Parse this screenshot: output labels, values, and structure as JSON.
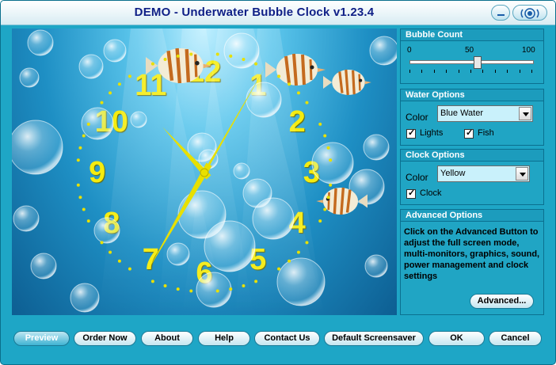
{
  "window": {
    "title": "DEMO - Underwater Bubble Clock v1.23.4"
  },
  "clock": {
    "numbers": [
      "12",
      "1",
      "2",
      "3",
      "4",
      "5",
      "6",
      "7",
      "8",
      "9",
      "10",
      "11"
    ],
    "hour_hand_color": "#e8e000",
    "time_hour": 10,
    "time_minute": 35,
    "time_second": 5
  },
  "bubble_count": {
    "title": "Bubble Count",
    "min_label": "0",
    "mid_label": "50",
    "max_label": "100",
    "value": 55
  },
  "water_options": {
    "title": "Water Options",
    "color_label": "Color",
    "color_value": "Blue Water",
    "lights_label": "Lights",
    "lights_checked": true,
    "fish_label": "Fish",
    "fish_checked": true
  },
  "clock_options": {
    "title": "Clock Options",
    "color_label": "Color",
    "color_value": "Yellow",
    "clock_label": "Clock",
    "clock_checked": true
  },
  "advanced_options": {
    "title": "Advanced Options",
    "description": "Click on the Advanced Button to adjust the full screen mode, multi-monitors, graphics, sound, power management and clock settings",
    "button_label": "Advanced..."
  },
  "buttons": {
    "preview": "Preview",
    "order_now": "Order Now",
    "about": "About",
    "help": "Help",
    "contact_us": "Contact Us",
    "default_screensaver": "Default Screensaver",
    "ok": "OK",
    "cancel": "Cancel"
  },
  "colors": {
    "accent": "#1ea6c6",
    "clock_yellow": "#f4ec10",
    "title_text": "#0f1f86"
  }
}
